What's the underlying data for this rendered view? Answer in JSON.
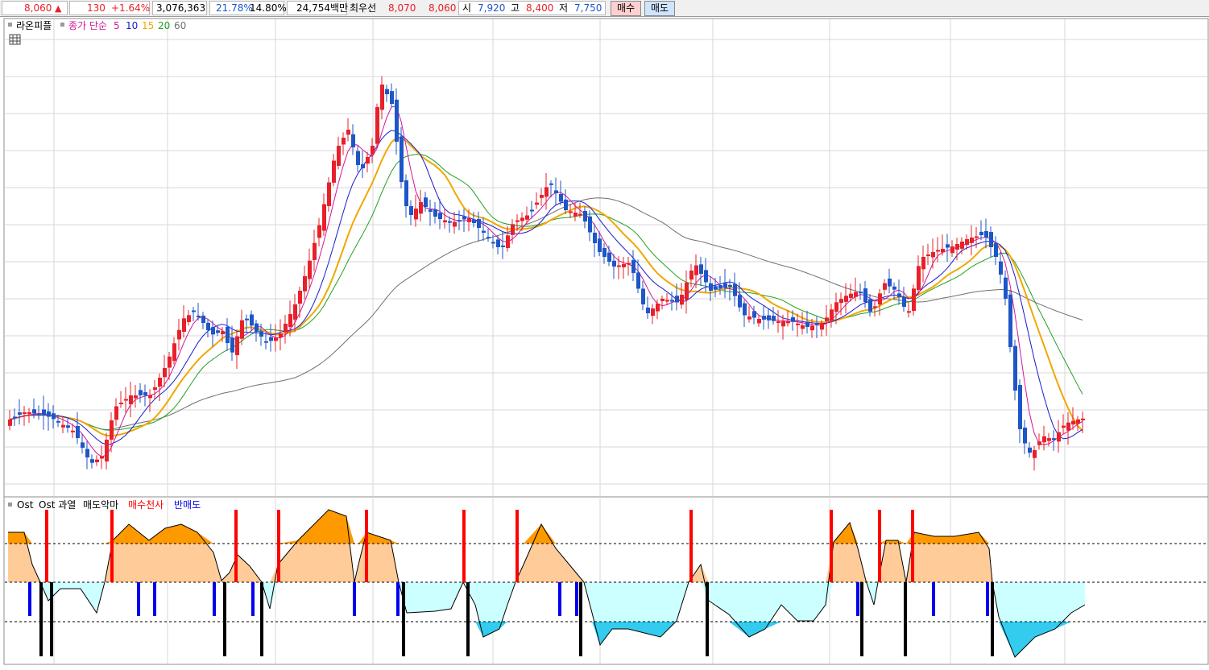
{
  "ticker": {
    "price": "8,060",
    "arrow": "▲",
    "change": "130",
    "change_pct": "+1.64%",
    "volume": "3,076,363",
    "ratio1": "21.78%",
    "ratio2": "14.80%",
    "amount": "24,754백만",
    "best_label": "최우선",
    "best_ask": "8,070",
    "best_bid": "8,060",
    "open_label": "시",
    "open": "7,920",
    "high_label": "고",
    "high": "8,400",
    "low_label": "저",
    "low": "7,750",
    "buy_label": "매수",
    "sell_label": "매도"
  },
  "colors": {
    "up": "#e8202a",
    "down": "#1e56c8",
    "ma5": "#d2169a",
    "ma10": "#1a1ad0",
    "ma15": "#f0a800",
    "ma20": "#22a022",
    "ma60": "#707070",
    "ost_pos": "#ffcc99",
    "ost_pos_hot": "#ff9900",
    "ost_neg": "#ccffff",
    "ost_neg_cold": "#33ccee",
    "signal_buy": "#ff0000",
    "signal_sell": "#0000ee",
    "signal_black": "#000000"
  },
  "price_panel": {
    "stock_name": "라온피플",
    "legend_prefix": "종가 단순",
    "ma_periods": [
      "5",
      "10",
      "15",
      "20",
      "60"
    ],
    "grid_icon": "grid-icon"
  },
  "indicator_panel": {
    "items": [
      {
        "label": "Ost",
        "color": "#000000"
      },
      {
        "label": "Ost 과열",
        "color": "#000000"
      },
      {
        "label": "매도악마",
        "color": "#000000"
      },
      {
        "label": "매수천사",
        "color": "#ff0000"
      },
      {
        "label": "반매도",
        "color": "#0000ee"
      }
    ]
  }
}
